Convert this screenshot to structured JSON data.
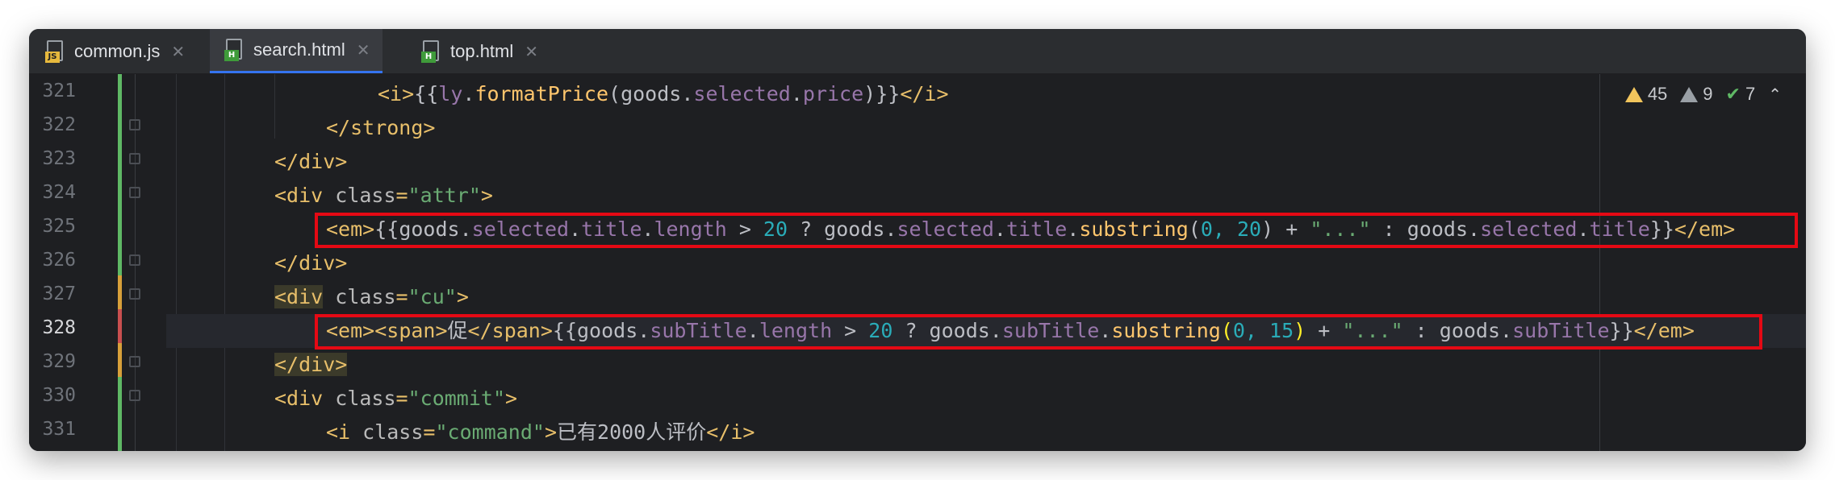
{
  "tabs": [
    {
      "label": "common.js",
      "icon": "js-file-icon",
      "badge": "JS",
      "active": false
    },
    {
      "label": "search.html",
      "icon": "html-file-icon",
      "badge": "H",
      "active": true
    },
    {
      "label": "top.html",
      "icon": "html-file-icon",
      "badge": "H",
      "active": false
    }
  ],
  "inspections": {
    "warnings": "45",
    "weak_warnings": "9",
    "ok": "7"
  },
  "line_numbers": [
    "321",
    "322",
    "323",
    "324",
    "325",
    "326",
    "327",
    "328",
    "329",
    "330",
    "331"
  ],
  "current_line": "328",
  "code": {
    "l321": {
      "t1": "<i>",
      "t2": "{{",
      "t3": "ly",
      "t4": ".",
      "t5": "formatPrice",
      "t6": "(",
      "t7": "goods",
      ".a": ".",
      "t8": "selected",
      "t9": ".",
      "t10": "price",
      "t11": ")}}",
      "t12": "</i>"
    },
    "l322": {
      "t1": "</strong>"
    },
    "l323": {
      "t1": "</div>"
    },
    "l324": {
      "t1": "<div ",
      "t2": "class",
      "t3": "=",
      "t4": "\"attr\"",
      "t5": ">"
    },
    "l325": {
      "t1": "<em>",
      "t2": "{{goods.",
      "t3": "selected",
      "t4": ".",
      "t5": "title",
      "t6": ".",
      "t7": "length",
      "t8": " > ",
      "t9": "20",
      "t10": " ? goods.",
      "t11": "selected",
      "t12": ".",
      "t13": "title",
      "t14": ".",
      "t15": "substring",
      "t16": "(",
      "t17": "0, 20",
      "t18": ") + ",
      "t19": "\"...\"",
      "t20": " : goods.",
      "t21": "selected",
      "t22": ".",
      "t23": "title",
      "t24": "}}",
      "t25": "</em>"
    },
    "l326": {
      "t1": "</div>"
    },
    "l327": {
      "t1": "<div",
      "t2": " class",
      "t3": "=",
      "t4": "\"cu\"",
      "t5": ">"
    },
    "l328": {
      "t1": "<em>",
      "t2": "<span>",
      "t3": "促",
      "t4": "</span>",
      "t5": "{{goods.",
      "t6": "subTitle",
      "t7": ".",
      "t8": "length",
      "t9": " > ",
      "t10": "20",
      "t11": " ? goods.",
      "t12": "subTitle",
      "t13": ".",
      "t14": "substring",
      "t15": "(",
      "t16": "0, 15",
      "t17": ")",
      "t18": " + ",
      "t19": "\"...\"",
      "t20": " : goods.",
      "t21": "subTitle",
      "t22": "}}",
      "t23": "</em>"
    },
    "l329": {
      "t1": "</div>"
    },
    "l330": {
      "t1": "<div ",
      "t2": "class",
      "t3": "=",
      "t4": "\"commit\"",
      "t5": ">"
    },
    "l331": {
      "t1": "<i ",
      "t2": "class",
      "t3": "=",
      "t4": "\"command\"",
      "t5": ">",
      "t6": "已有2000人评价",
      "t7": "</i>"
    }
  },
  "colors": {
    "highlight_box": "#e50914",
    "vcs_added": "#5fb865",
    "vcs_modified": "#d8a03a",
    "vcs_current_error": "#c94f4f",
    "active_tab_underline": "#3574f0"
  }
}
